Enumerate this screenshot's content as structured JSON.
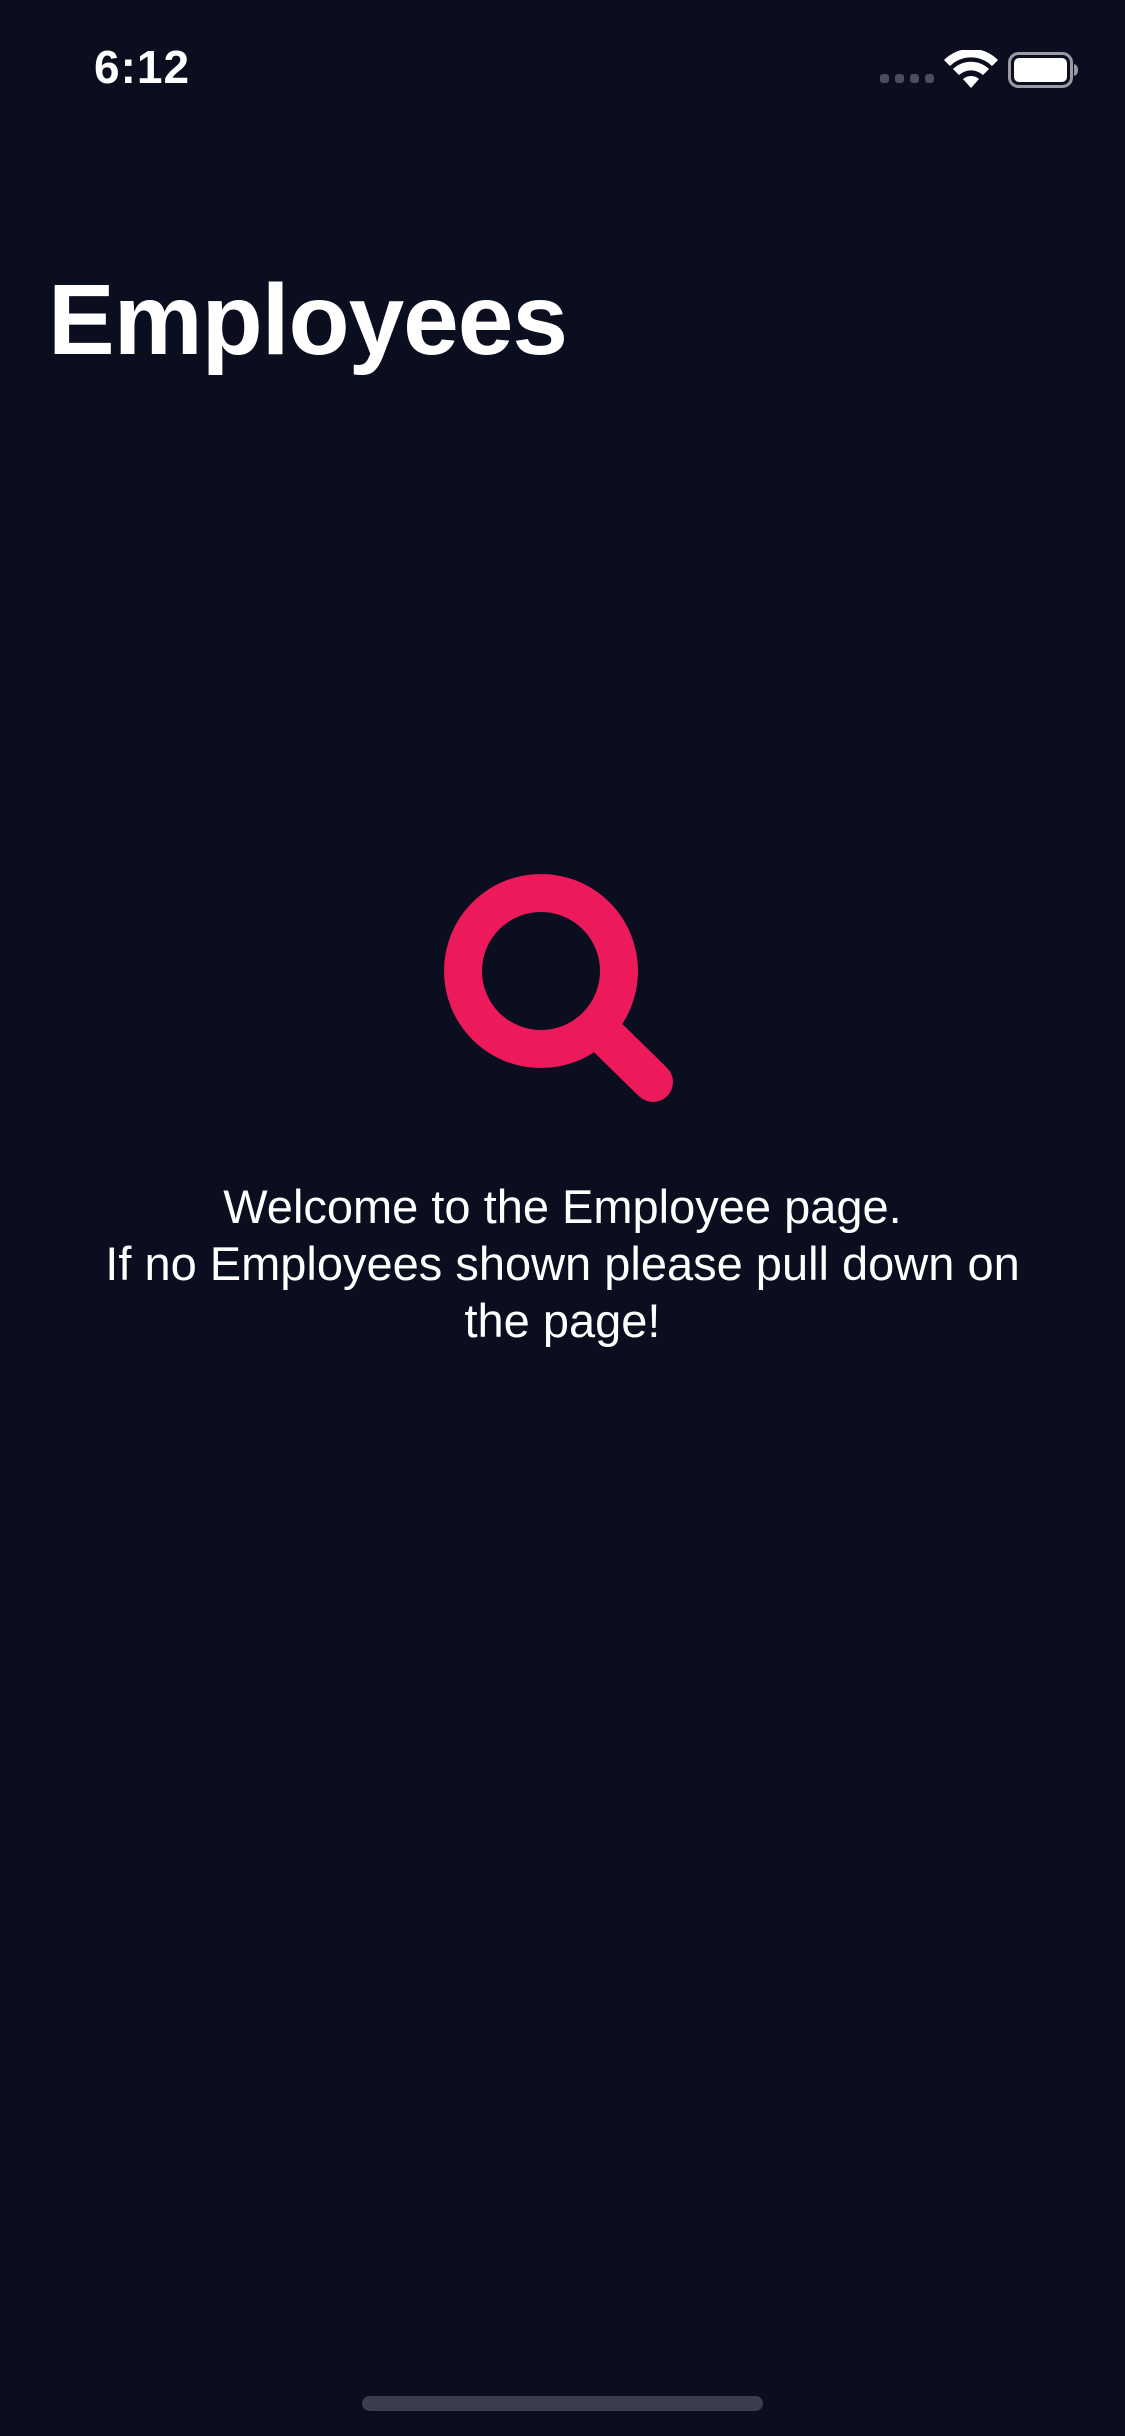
{
  "status_bar": {
    "time": "6:12",
    "signal_icon": "cellular-signal-icon",
    "wifi_icon": "wifi-icon",
    "battery_icon": "battery-icon"
  },
  "header": {
    "title": "Employees"
  },
  "empty_state": {
    "icon": "search-icon",
    "icon_color": "#ec1a5b",
    "message_lines": [
      "Welcome to the Employee page.",
      "If no Employees shown please pull down on",
      "the page!"
    ]
  },
  "colors": {
    "background": "#0a0e1f",
    "text": "#ffffff",
    "accent": "#ec1a5b"
  }
}
